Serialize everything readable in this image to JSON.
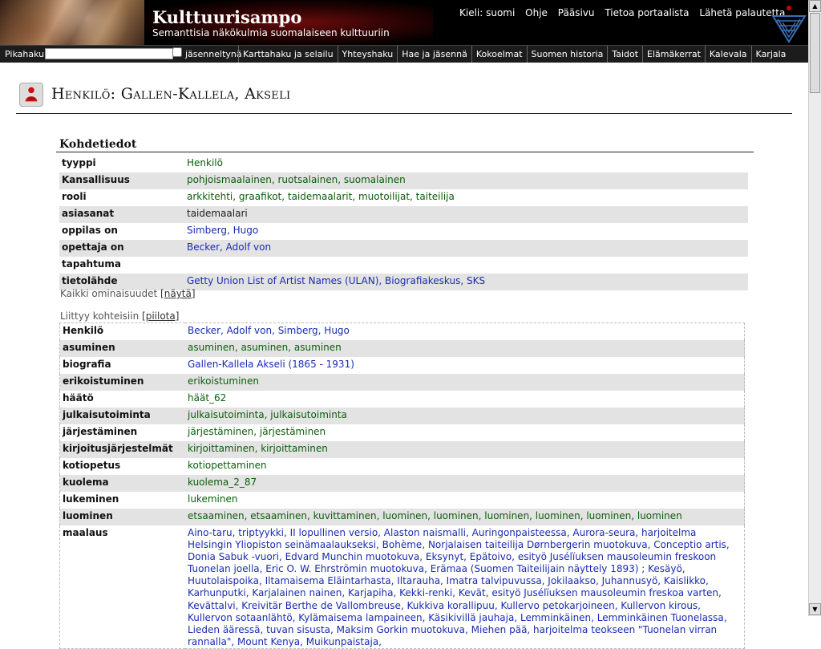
{
  "header": {
    "title": "Kulttuurisampo",
    "subtitle": "Semanttisia näkökulmia suomalaiseen kulttuuriin",
    "links": [
      "Kieli: suomi",
      "Ohje",
      "Pääsivu",
      "Tietoa portaalista",
      "Lähetä palautetta"
    ]
  },
  "navbar": {
    "search_label": "Pikahaku:",
    "search_value": "",
    "checkbox_label": "jäsenneltynä",
    "items": [
      "Karttahaku ja selailu",
      "Yhteyshaku",
      "Hae ja jäsennä",
      "Kokoelmat",
      "Suomen historia",
      "Taidot",
      "Elämäkerrat",
      "Kalevala",
      "Karjala"
    ]
  },
  "page": {
    "title": "Henkilö: Gallen-Kallela, Akseli"
  },
  "details": {
    "heading": "Kohdetiedot",
    "rows": [
      {
        "key": "tyyppi",
        "value": "Henkilö",
        "color": "green"
      },
      {
        "key": "Kansallisuus",
        "value": "pohjoismaalainen, ruotsalainen, suomalainen",
        "color": "green"
      },
      {
        "key": "rooli",
        "value": "arkkitehti, graafikot, taidemaalarit, muotoilijat, taiteilija",
        "color": "green"
      },
      {
        "key": "asiasanat",
        "value": "taidemaalari",
        "color": "plain"
      },
      {
        "key": "oppilas on",
        "value": "Simberg, Hugo",
        "color": "blue"
      },
      {
        "key": "opettaja on",
        "value": "Becker, Adolf von",
        "color": "blue"
      },
      {
        "key": "tapahtuma",
        "value": "",
        "color": "plain"
      },
      {
        "key": "tietolähde",
        "value": "Getty Union List of Artist Names (ULAN), Biografiakeskus, SKS",
        "color": "blue"
      }
    ],
    "all_props_label": "Kaikki ominaisuudet",
    "all_props_toggle": "[näytä]",
    "related_label": "Liittyy kohteisiin",
    "related_toggle": "[piilota]"
  },
  "related": {
    "rows": [
      {
        "key": "Henkilö",
        "value": "Becker, Adolf von, Simberg, Hugo",
        "color": "blue"
      },
      {
        "key": "asuminen",
        "value": "asuminen, asuminen, asuminen",
        "color": "green"
      },
      {
        "key": "biografia",
        "value": "Gallen-Kallela Akseli (1865 - 1931)",
        "color": "blue"
      },
      {
        "key": "erikoistuminen",
        "value": "erikoistuminen",
        "color": "green"
      },
      {
        "key": "häätö",
        "value": "häät_62",
        "color": "green"
      },
      {
        "key": "julkaisutoiminta",
        "value": "julkaisutoiminta, julkaisutoiminta",
        "color": "green"
      },
      {
        "key": "järjestäminen",
        "value": "järjestäminen, järjestäminen",
        "color": "green"
      },
      {
        "key": "kirjoitusjärjestelmät",
        "value": "kirjoittaminen, kirjoittaminen",
        "color": "green"
      },
      {
        "key": "kotiopetus",
        "value": "kotiopettaminen",
        "color": "green"
      },
      {
        "key": "kuolema",
        "value": "kuolema_2_87",
        "color": "green"
      },
      {
        "key": "lukeminen",
        "value": "lukeminen",
        "color": "green"
      },
      {
        "key": "luominen",
        "value": "etsaaminen, etsaaminen, kuvittaminen, luominen, luominen, luominen, luominen, luominen, luominen",
        "color": "green"
      }
    ],
    "maalaus_key": "maalaus",
    "maalaus_value": "Aino-taru, triptyykki, II lopullinen versio, Alaston naismalli, Auringonpaisteessa, Aurora-seura, harjoitelma Helsingin Yliopiston seinämaalaukseksi, Bohème, Norjalaisen taiteilija Dørnbergerin muotokuva, Conceptio artis, Donia Sabuk -vuori, Edvard Munchin muotokuva, Eksynyt, Epätoivo, esityö Jusélïuksen mausoleumin freskoon Tuonelan joella, Eric O. W. Ehrströmin muotokuva, Erämaa (Suomen Taiteilijain näyttely 1893) ; Kesäyö, Huutolaispoika, Iltamaisema Eläintarhasta, Iltarauha, Imatra talvipuvussa, Jokilaakso, Juhannusyö, Kaislikko, Karhunputki, Karjalainen nainen, Karjapiha, Kekki-renki, Kevät, esityö Jusélïuksen mausoleumin freskoa varten, Kevättalvi, Kreivitär Berthe de Vallombreuse, Kukkiva korallipuu, Kullervo petokarjoineen, Kullervon kirous, Kullervon sotaanlähtö, Kylämaisema lampaineen, Käsikivillä jauhaja, Lemminkäinen, Lemminkäinen Tuonelassa, Lieden ääressä, tuvan sisusta, Maksim Gorkin muotokuva, Miehen pää, harjoitelma teokseen \"Tuonelan virran rannalla\", Mount Kenya, Muikunpaistaja,"
  }
}
